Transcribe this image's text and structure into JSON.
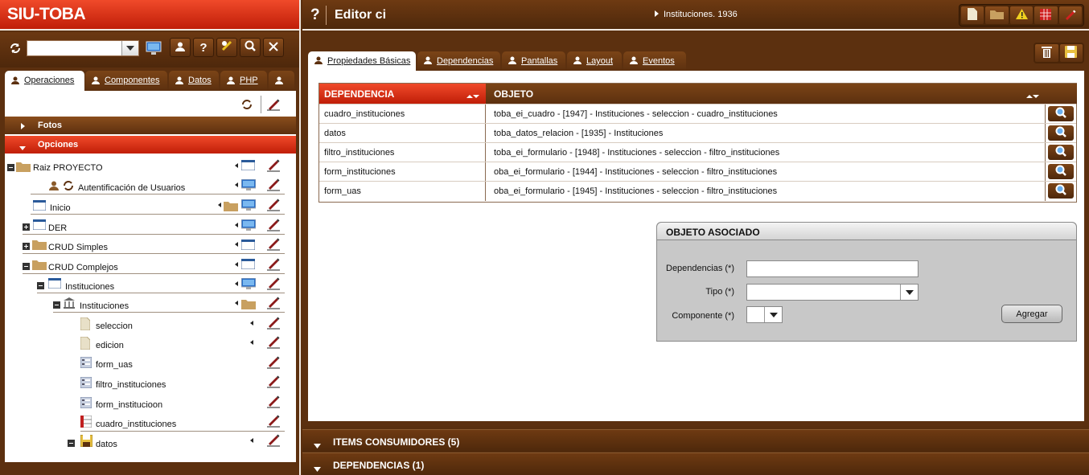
{
  "app": {
    "logo": "SIU-TOBA"
  },
  "left": {
    "project_select_value": "",
    "tabs": [
      {
        "label": "Operaciones",
        "active": true
      },
      {
        "label": "Componentes",
        "active": false
      },
      {
        "label": "Datos",
        "active": false
      },
      {
        "label": "PHP",
        "active": false
      },
      {
        "label": "",
        "active": false
      }
    ],
    "sections": {
      "fotos": "Fotos",
      "opciones": "Opciones"
    },
    "tree": [
      {
        "label": "Raiz PROYECTO",
        "icon": "folder-icon"
      },
      {
        "label": "Autentificación de Usuarios",
        "icon": "user-cycle-icon"
      },
      {
        "label": "Inicio",
        "icon": "window-icon"
      },
      {
        "label": "DER",
        "icon": "window-icon"
      },
      {
        "label": "CRUD Simples",
        "icon": "folder-icon"
      },
      {
        "label": "CRUD Complejos",
        "icon": "folder-icon"
      },
      {
        "label": "Instituciones",
        "icon": "window-icon"
      },
      {
        "label": "Instituciones",
        "icon": "building-icon"
      },
      {
        "label": "seleccion",
        "icon": "page-icon"
      },
      {
        "label": "edicion",
        "icon": "page-icon"
      },
      {
        "label": "form_uas",
        "icon": "form-icon"
      },
      {
        "label": "filtro_instituciones",
        "icon": "form-icon"
      },
      {
        "label": "form_institucioon",
        "icon": "form-icon"
      },
      {
        "label": "cuadro_instituciones",
        "icon": "grid-icon"
      },
      {
        "label": "datos",
        "icon": "datos-icon"
      }
    ]
  },
  "editor": {
    "help": "?",
    "title": "Editor ci",
    "breadcrumb": "Instituciones. 1936",
    "tabs": [
      {
        "label": "Propiedades Básicas",
        "active": true
      },
      {
        "label": "Dependencias",
        "active": false
      },
      {
        "label": "Pantallas",
        "active": false
      },
      {
        "label": "Layout",
        "active": false
      },
      {
        "label": "Eventos",
        "active": false
      }
    ],
    "table": {
      "headers": {
        "dependencia": "DEPENDENCIA",
        "objeto": "OBJETO"
      },
      "rows": [
        {
          "dependencia": "cuadro_instituciones",
          "objeto": "toba_ei_cuadro - [1947] - Instituciones - seleccion - cuadro_instituciones"
        },
        {
          "dependencia": "datos",
          "objeto": "toba_datos_relacion - [1935] - Instituciones"
        },
        {
          "dependencia": "filtro_instituciones",
          "objeto": "toba_ei_formulario - [1948] - Instituciones - seleccion - filtro_instituciones"
        },
        {
          "dependencia": "form_instituciones",
          "objeto": "oba_ei_formulario - [1944] - Instituciones - seleccion - filtro_instituciones"
        },
        {
          "dependencia": "form_uas",
          "objeto": "oba_ei_formulario - [1945] - Instituciones - seleccion - filtro_instituciones"
        }
      ]
    },
    "form": {
      "title": "OBJETO ASOCIADO",
      "dependencias_label": "Dependencias (*)",
      "dependencias_value": "",
      "tipo_label": "Tipo (*)",
      "tipo_value": "",
      "componente_label": "Componente (*)",
      "componente_value": "",
      "agregar_label": "Agregar"
    },
    "bottom": {
      "items_consumidores": "ITEMS CONSUMIDORES (5)",
      "dependencias": "DEPENDENCIAS (1)"
    }
  },
  "colors": {
    "brown": "#5c300f",
    "red": "#d8280e",
    "white": "#ffffff"
  }
}
